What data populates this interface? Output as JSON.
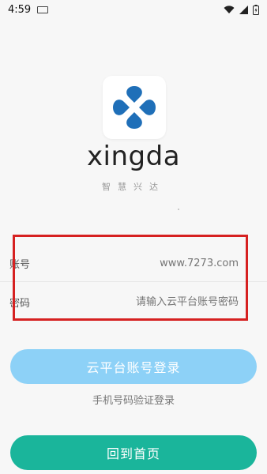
{
  "status_bar": {
    "time": "4:59"
  },
  "brand": {
    "name": "xingda",
    "tagline": "智慧兴达"
  },
  "form": {
    "account_label": "账号",
    "account_placeholder": "www.7273.com",
    "password_label": "密码",
    "password_placeholder": "请输入云平台账号密码"
  },
  "actions": {
    "cloud_login": "云平台账号登录",
    "sms_login": "手机号码验证登录",
    "back_home": "回到首页"
  },
  "colors": {
    "login_button": "#8dd1f7",
    "home_button": "#1ab59b",
    "highlight_border": "#d62121",
    "logo_blue": "#1f6fb8"
  }
}
